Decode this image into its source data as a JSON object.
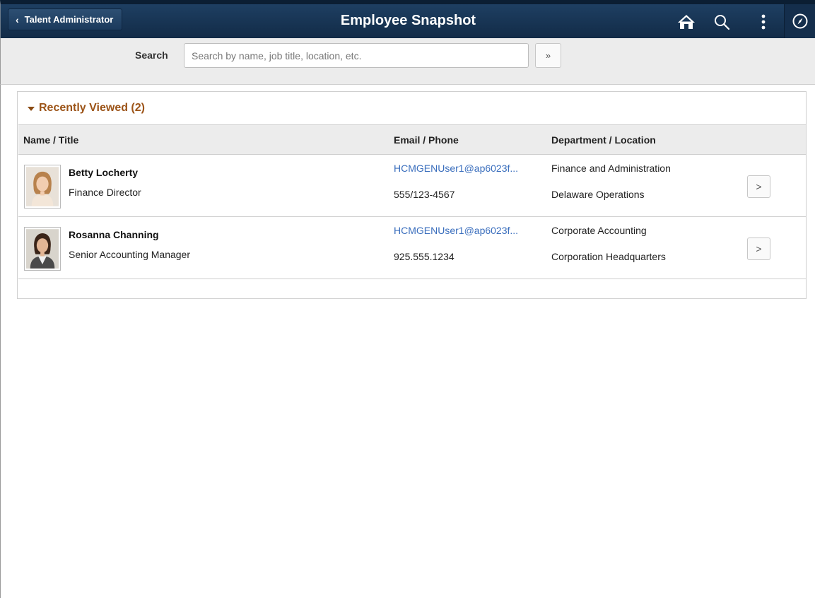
{
  "header": {
    "back_label": "Talent Administrator",
    "title": "Employee Snapshot",
    "icons": [
      "home-icon",
      "search-icon",
      "actions-menu-icon",
      "navbar-compass-icon"
    ]
  },
  "search": {
    "label": "Search",
    "placeholder": "Search by name, job title, location, etc.",
    "value": "",
    "go_label": "»"
  },
  "recently_viewed": {
    "title": "Recently Viewed (2)",
    "columns": {
      "name_title": "Name / Title",
      "email_phone": "Email / Phone",
      "dept_location": "Department / Location"
    },
    "rows": [
      {
        "name": "Betty Locherty",
        "title": "Finance Director",
        "email": "HCMGENUser1@ap6023f...",
        "phone": "555/123-4567",
        "department": "Finance and Administration",
        "location": "Delaware Operations",
        "action_label": ">"
      },
      {
        "name": "Rosanna Channing",
        "title": "Senior Accounting Manager",
        "email": "HCMGENUser1@ap6023f...",
        "phone": "925.555.1234",
        "department": "Corporate Accounting",
        "location": "Corporation Headquarters",
        "action_label": ">"
      }
    ]
  },
  "colors": {
    "banner": "#1b3a5c",
    "group_title": "#9c5418",
    "link": "#3a6ebd"
  }
}
